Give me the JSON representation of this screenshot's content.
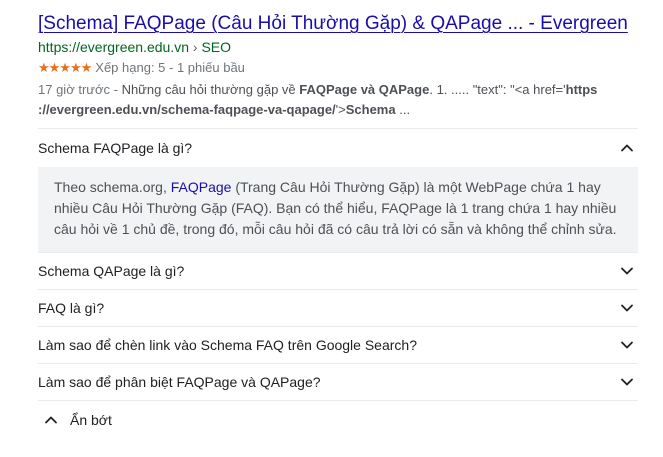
{
  "result": {
    "title": "[Schema] FAQPage (Câu Hỏi Thường Gặp) & QAPage ... - Evergreen",
    "url_domain": "https://evergreen.edu.vn",
    "url_sep": " › ",
    "url_path": "SEO",
    "stars": "★★★★★",
    "rating_text": "Xếp hạng: 5 - 1 phiếu bầu",
    "snippet": {
      "time": "17 giờ trước",
      "dash": " - ",
      "t1": "Những câu hỏi thường gặp về ",
      "b1": "FAQPage và QAPage",
      "t2": ". 1. ..... \"text\": \"<a href='",
      "b2": "https",
      "b3": "://evergreen.edu.vn/schema-faqpage-va-qapage/",
      "t3": "'>",
      "b4": "Schema",
      "t4": " ..."
    }
  },
  "faq": {
    "q1": "Schema FAQPage là gì?",
    "a1_pre": "Theo schema.org, ",
    "a1_link": "FAQPage",
    "a1_post": " (Trang Câu Hỏi Thường Gặp) là một WebPage chứa 1 hay nhiều Câu Hỏi Thường Gặp (FAQ). Bạn có thể hiểu, FAQPage là 1 trang chứa 1 hay nhiều câu hỏi về 1 chủ đề, trong đó, mỗi câu hỏi đã có câu trả lời có sẵn và không thể chỉnh sửa.",
    "q2": "Schema QAPage là gì?",
    "q3": "FAQ là gì?",
    "q4": "Làm sao để chèn link vào Schema FAQ trên Google Search?",
    "q5": "Làm sao để phân biệt FAQPage và QAPage?"
  },
  "collapse_label": "Ẩn bớt",
  "icons": {
    "expanded": "chevron-up-icon",
    "collapsed": "chevron-down-icon"
  },
  "colors": {
    "title_link": "#1a0dab",
    "url_green": "#006621",
    "stars": "#e7711b",
    "answer_bg": "#f1f3f4"
  }
}
